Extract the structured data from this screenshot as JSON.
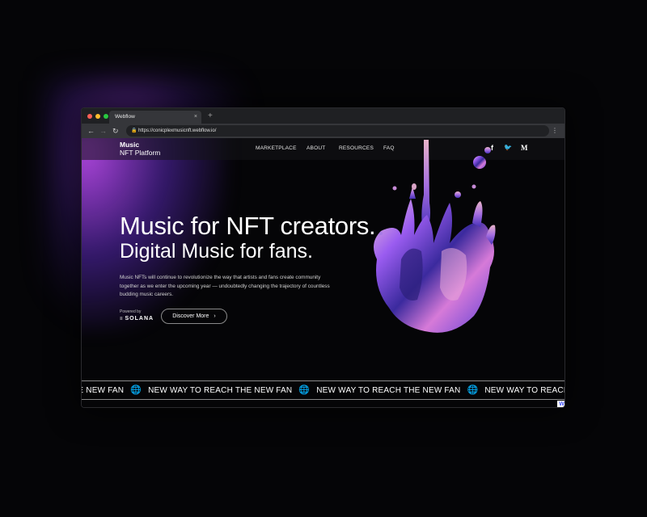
{
  "browser": {
    "tab_title": "Webflow",
    "tab_close": "×",
    "new_tab": "+",
    "url": "https://conicplexmusicnft.webflow.io/",
    "back": "←",
    "forward": "→",
    "reload": "↻",
    "menu": "⋮"
  },
  "site": {
    "logo_line1": "Music",
    "logo_line2": "NFT Platform",
    "nav": [
      "MARKETPLACE",
      "ABOUT",
      "RESOURCES",
      "FAQ"
    ],
    "social": [
      "f",
      "🐦",
      "M"
    ]
  },
  "hero": {
    "title": "Music for NFT creators.",
    "subtitle": "Digital Music for fans.",
    "description": "Music NFTs will continue to revolutionize the way that artists and fans create community together as we enter the upcoming year — undoubtedly changing the trajectory of countless budding music careers.",
    "powered_by": "Powered by",
    "powered_brand": "SOLANA",
    "cta_label": "Discover More",
    "cta_chevron": "›"
  },
  "marquee": {
    "items": [
      "HE NEW FAN",
      "NEW WAY TO REACH THE NEW FAN",
      "NEW WAY TO REACH THE NEW FAN",
      "NEW WAY TO REACH THE NEW FAN"
    ],
    "icon": "🌐"
  },
  "badge": {
    "label": "W"
  },
  "colors": {
    "accent_purple": "#b44dff",
    "background": "#050507",
    "chrome_dark": "#35363a"
  }
}
